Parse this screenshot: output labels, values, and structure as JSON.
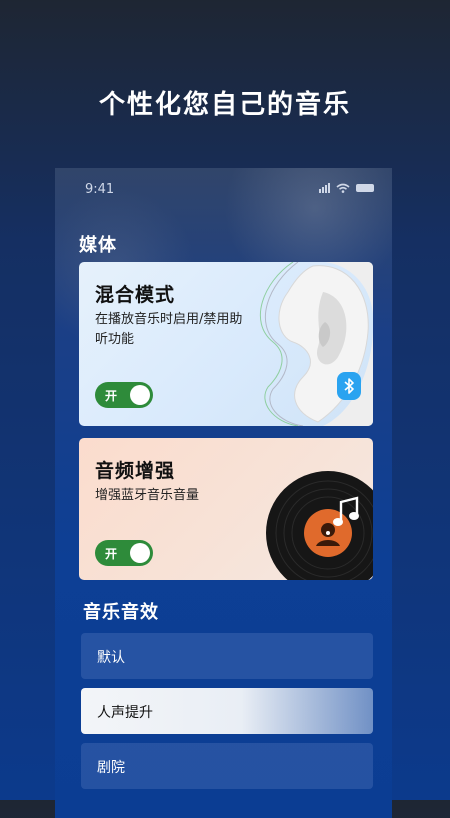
{
  "headline": "个性化您自己的音乐",
  "status_bar": {
    "time": "9:41"
  },
  "media_section": {
    "title": "媒体",
    "cards": [
      {
        "title": "混合模式",
        "description": "在播放音乐时启用/禁用助听功能",
        "toggle_label": "开",
        "enabled": true
      },
      {
        "title": "音频增强",
        "description": "增强蓝牙音乐音量",
        "toggle_label": "开",
        "enabled": true
      }
    ]
  },
  "effects_section": {
    "title": "音乐音效",
    "items": [
      {
        "label": "默认",
        "selected": false
      },
      {
        "label": "人声提升",
        "selected": true
      },
      {
        "label": "剧院",
        "selected": false
      }
    ]
  },
  "colors": {
    "toggle_on": "#2e8b3a",
    "bluetooth_badge": "#2aa3f0",
    "vinyl_accent": "#e06a2c"
  },
  "icons": [
    "wifi-icon",
    "battery-icon",
    "signal-icon",
    "bluetooth-icon",
    "ear-image",
    "vinyl-record-image",
    "music-note-icon"
  ]
}
